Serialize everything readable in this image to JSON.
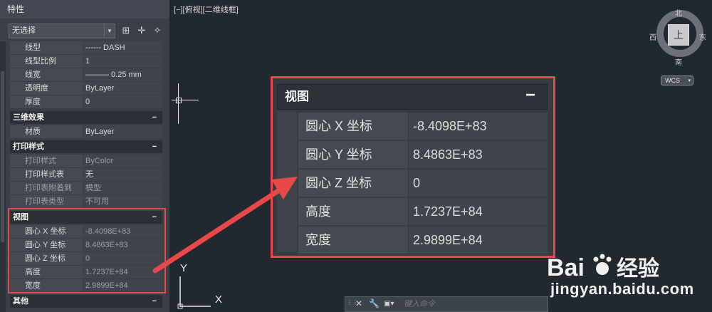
{
  "palette": {
    "title": "特性",
    "selection": "无选择",
    "general_rows": [
      {
        "label": "线型",
        "value": "------ DASH"
      },
      {
        "label": "线型比例",
        "value": "1"
      },
      {
        "label": "线宽",
        "value": "——— 0.25 mm"
      },
      {
        "label": "透明度",
        "value": "ByLayer"
      },
      {
        "label": "厚度",
        "value": "0"
      }
    ],
    "sections": {
      "effects": {
        "title": "三维效果",
        "toggle": "−",
        "rows": [
          {
            "label": "材质",
            "value": "ByLayer"
          }
        ]
      },
      "plot": {
        "title": "打印样式",
        "toggle": "−",
        "rows": [
          {
            "label": "打印样式",
            "value": "ByColor"
          },
          {
            "label": "打印样式表",
            "value": "无"
          },
          {
            "label": "打印表附着到",
            "value": "模型"
          },
          {
            "label": "打印表类型",
            "value": "不可用"
          }
        ]
      },
      "view": {
        "title": "视图",
        "toggle": "−",
        "rows": [
          {
            "label": "圆心 X 坐标",
            "value": "-8.4098E+83"
          },
          {
            "label": "圆心 Y 坐标",
            "value": "8.4863E+83"
          },
          {
            "label": "圆心 Z 坐标",
            "value": "0"
          },
          {
            "label": "高度",
            "value": "1.7237E+84"
          },
          {
            "label": "宽度",
            "value": "2.9899E+84"
          }
        ]
      },
      "misc": {
        "title": "其他",
        "toggle": "−"
      }
    }
  },
  "viewport": {
    "label": "[−][俯视][二维线框]",
    "ucs_y": "Y",
    "ucs_x": "X"
  },
  "viewcube": {
    "north": "北",
    "south": "南",
    "east": "东",
    "west": "西",
    "face": "上",
    "wcs": "WCS"
  },
  "command": {
    "placeholder": "键入命令"
  },
  "watermark": {
    "brand": "Bai 经验",
    "url": "jingyan.baidu.com"
  },
  "colors": {
    "highlight": "#e84848"
  }
}
